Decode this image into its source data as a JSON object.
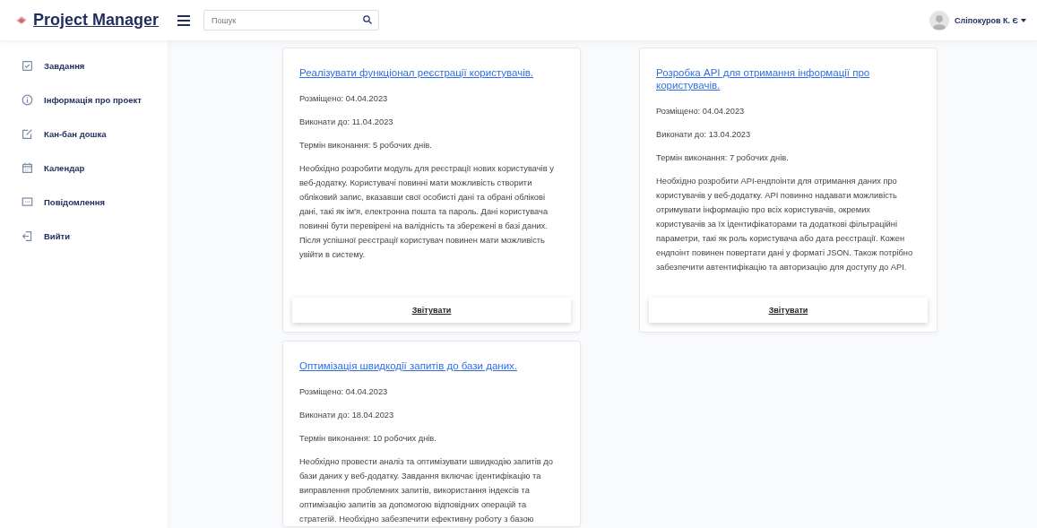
{
  "header": {
    "logo": "Project Manager",
    "search": {
      "placeholder": "Пошук"
    },
    "user": {
      "name": "Сліпокуров К. Є"
    }
  },
  "sidebar": {
    "items": [
      {
        "label": "Завдання"
      },
      {
        "label": "Інформація про проект"
      },
      {
        "label": "Кан-бан дошка"
      },
      {
        "label": "Календар"
      },
      {
        "label": "Повідомлення"
      },
      {
        "label": "Вийти"
      }
    ]
  },
  "tasks": [
    {
      "title": "Реалізувати функціонал реєстрації користувачів.",
      "posted": "Розміщено: 04.04.2023",
      "due": "Виконати до: 11.04.2023",
      "duration": "Термін виконання: 5 робочих днів.",
      "description": "Необхідно розробити модуль для реєстрації нових користувачів у веб-додатку. Користувачі повинні мати можливість створити обліковий запис, вказавши свої особисті дані та обрані облікові дані, такі як ім'я, електронна пошта та пароль. Дані користувача повинні бути перевірені на валідність та збережені в базі даних. Після успішної реєстрації користувач повинен мати можливість увійти в систему.",
      "button": "Звітувати"
    },
    {
      "title": "Розробка API для отримання інформації про користувачів.",
      "posted": "Розміщено: 04.04.2023",
      "due": "Виконати до: 13.04.2023",
      "duration": "Термін виконання: 7 робочих днів.",
      "description": "Необхідно розробити API-ендпоінти для отримання даних про користувачів у веб-додатку. API повинно надавати можливість отримувати інформацію про всіх користувачів, окремих користувачів за їх ідентифікаторами та додаткові фільтраційні параметри, такі як роль користувача або дата реєстрації. Кожен ендпоінт повинен повертати дані у форматі JSON. Також потрібно забезпечити автентифікацію та авторизацію для доступу до API.",
      "button": "Звітувати"
    },
    {
      "title": "Оптимізація швидкодії запитів до бази даних.",
      "posted": "Розміщено: 04.04.2023",
      "due": "Виконати до: 18.04.2023",
      "duration": "Термін виконання: 10 робочих днів.",
      "description": "Необхідно провести аналіз та оптимізувати швидкодію запитів до бази даних у веб-додатку. Завдання включає ідентифікацію та виправлення проблемних запитів, використання індексів та оптимізацію запитів за допомогою відповідних операцій та стратегій. Необхідно забезпечити ефективну роботу з базою"
    }
  ]
}
